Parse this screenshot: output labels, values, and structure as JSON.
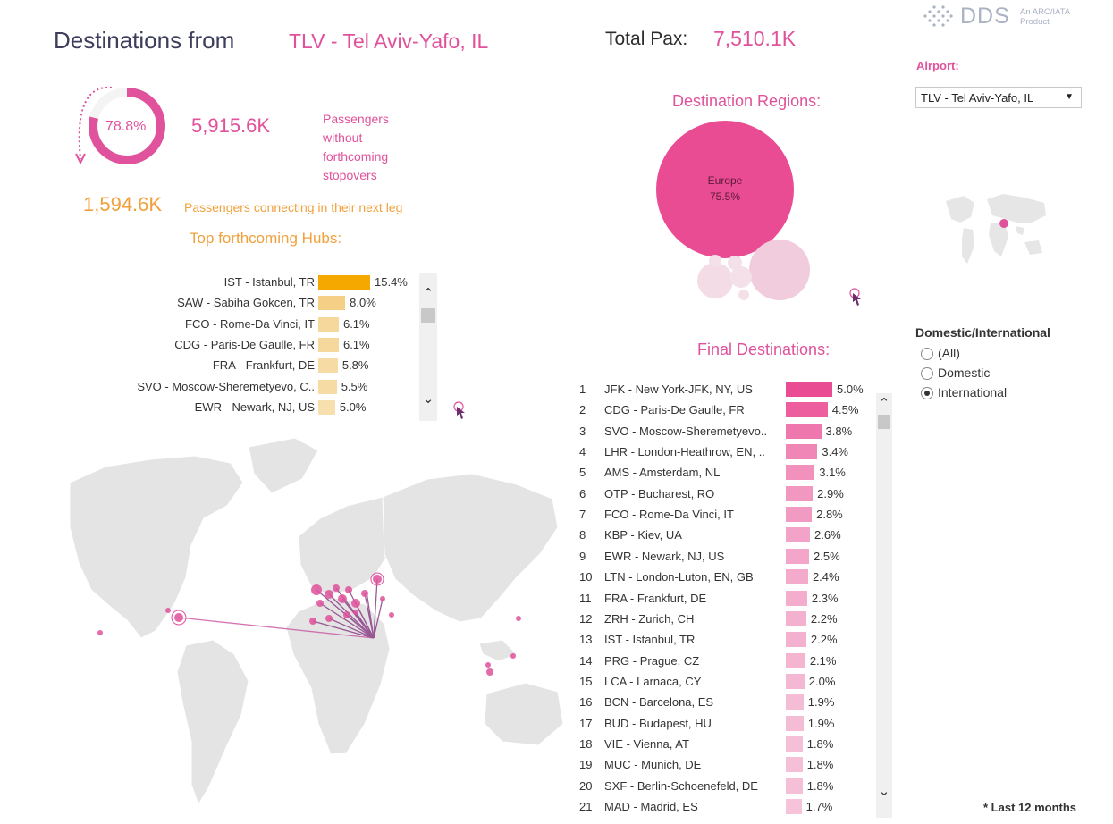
{
  "header": {
    "title": "Destinations from",
    "airport": "TLV - Tel Aviv-Yafo, IL",
    "total_label": "Total Pax:",
    "total_value": "7,510.1K"
  },
  "logo": {
    "text": "DDS",
    "sub_line1": "An ARC/IATA",
    "sub_line2": "Product"
  },
  "summary": {
    "donut_pct": "78.8%",
    "donut_fraction": 0.788,
    "no_stopover_value": "5,915.6K",
    "no_stopover_label": "Passengers without forthcoming stopovers",
    "connecting_value": "1,594.6K",
    "connecting_label": "Passengers connecting in their next leg"
  },
  "hubs": {
    "title": "Top forthcoming Hubs:",
    "items": [
      {
        "label": "IST - Istanbul, TR",
        "pct": "15.4%",
        "value": 15.4,
        "color": "#f5a800"
      },
      {
        "label": "SAW - Sabiha Gokcen, TR",
        "pct": "8.0%",
        "value": 8.0,
        "color": "#f6cf86"
      },
      {
        "label": "FCO - Rome-Da Vinci, IT",
        "pct": "6.1%",
        "value": 6.1,
        "color": "#f6d79c"
      },
      {
        "label": "CDG - Paris-De Gaulle, FR",
        "pct": "6.1%",
        "value": 6.1,
        "color": "#f6d79c"
      },
      {
        "label": "FRA - Frankfurt, DE",
        "pct": "5.8%",
        "value": 5.8,
        "color": "#f7dba4"
      },
      {
        "label": "SVO - Moscow-Sheremetyevo, C..",
        "pct": "5.5%",
        "value": 5.5,
        "color": "#f7dba4"
      },
      {
        "label": "EWR - Newark, NJ, US",
        "pct": "5.0%",
        "value": 5.0,
        "color": "#f8dfae"
      }
    ]
  },
  "regions": {
    "title": "Destination Regions:",
    "main_label": "Europe",
    "main_pct": "75.5%"
  },
  "destinations": {
    "title": "Final Destinations:",
    "items": [
      {
        "rank": "1",
        "label": "JFK - New York-JFK, NY, US",
        "pct": "5.0%",
        "value": 5.0
      },
      {
        "rank": "2",
        "label": "CDG - Paris-De Gaulle, FR",
        "pct": "4.5%",
        "value": 4.5
      },
      {
        "rank": "3",
        "label": "SVO - Moscow-Sheremetyevo..",
        "pct": "3.8%",
        "value": 3.8
      },
      {
        "rank": "4",
        "label": "LHR - London-Heathrow, EN, ..",
        "pct": "3.4%",
        "value": 3.4
      },
      {
        "rank": "5",
        "label": "AMS - Amsterdam, NL",
        "pct": "3.1%",
        "value": 3.1
      },
      {
        "rank": "6",
        "label": "OTP - Bucharest, RO",
        "pct": "2.9%",
        "value": 2.9
      },
      {
        "rank": "7",
        "label": "FCO - Rome-Da Vinci, IT",
        "pct": "2.8%",
        "value": 2.8
      },
      {
        "rank": "8",
        "label": "KBP - Kiev, UA",
        "pct": "2.6%",
        "value": 2.6
      },
      {
        "rank": "9",
        "label": "EWR - Newark, NJ, US",
        "pct": "2.5%",
        "value": 2.5
      },
      {
        "rank": "10",
        "label": "LTN - London-Luton, EN, GB",
        "pct": "2.4%",
        "value": 2.4
      },
      {
        "rank": "11",
        "label": "FRA - Frankfurt, DE",
        "pct": "2.3%",
        "value": 2.3
      },
      {
        "rank": "12",
        "label": "ZRH - Zurich, CH",
        "pct": "2.2%",
        "value": 2.2
      },
      {
        "rank": "13",
        "label": "IST - Istanbul, TR",
        "pct": "2.2%",
        "value": 2.2
      },
      {
        "rank": "14",
        "label": "PRG - Prague, CZ",
        "pct": "2.1%",
        "value": 2.1
      },
      {
        "rank": "15",
        "label": "LCA - Larnaca, CY",
        "pct": "2.0%",
        "value": 2.0
      },
      {
        "rank": "16",
        "label": "BCN - Barcelona, ES",
        "pct": "1.9%",
        "value": 1.9
      },
      {
        "rank": "17",
        "label": "BUD - Budapest, HU",
        "pct": "1.9%",
        "value": 1.9
      },
      {
        "rank": "18",
        "label": "VIE - Vienna, AT",
        "pct": "1.8%",
        "value": 1.8
      },
      {
        "rank": "19",
        "label": "MUC - Munich, DE",
        "pct": "1.8%",
        "value": 1.8
      },
      {
        "rank": "20",
        "label": "SXF - Berlin-Schoenefeld, DE",
        "pct": "1.8%",
        "value": 1.8
      },
      {
        "rank": "21",
        "label": "MAD - Madrid, ES",
        "pct": "1.7%",
        "value": 1.7
      }
    ]
  },
  "filters": {
    "airport_label": "Airport:",
    "airport_value": "TLV - Tel Aviv-Yafo, IL",
    "dom_label": "Domestic/International",
    "options": [
      {
        "label": "(All)",
        "selected": false
      },
      {
        "label": "Domestic",
        "selected": false
      },
      {
        "label": "International",
        "selected": true
      }
    ]
  },
  "footnote": "* Last 12 months",
  "colors": {
    "pink": "#e0529b",
    "orange": "#f0a13c",
    "hub_top": "#f5a800",
    "route_line": "#8a3f86"
  }
}
